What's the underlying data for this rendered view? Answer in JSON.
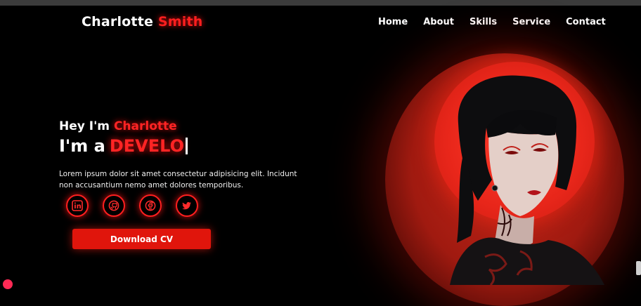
{
  "brand": {
    "first": "Charlotte",
    "last": "Smith"
  },
  "nav": {
    "items": [
      "Home",
      "About",
      "Skills",
      "Service",
      "Contact"
    ]
  },
  "hero": {
    "greeting_prefix": "Hey I'm",
    "greeting_name": "Charlotte",
    "role_prefix": "I'm a",
    "role_typed": "DEVELO",
    "description": "Lorem ipsum dolor sit amet consectetur adipisicing elit. Incidunt non accusantium nemo amet dolores temporibus."
  },
  "socials": [
    {
      "name": "linkedin-icon",
      "glyph": "in"
    },
    {
      "name": "github-icon",
      "glyph": ""
    },
    {
      "name": "facebook-icon",
      "glyph": "f"
    },
    {
      "name": "twitter-icon",
      "glyph": ""
    }
  ],
  "cta": {
    "label": "Download CV"
  },
  "colors": {
    "accent": "#ff1f1f",
    "button": "#e0150c",
    "background": "#000000"
  }
}
